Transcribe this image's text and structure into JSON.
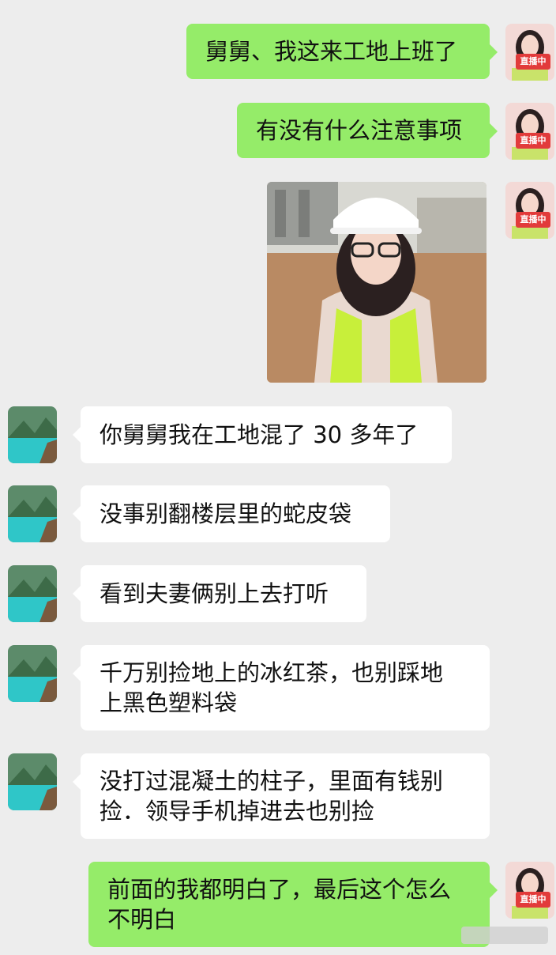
{
  "badge_label": "直播中",
  "messages": [
    {
      "side": "right",
      "lines": [
        "舅舅、我这来工地上班了"
      ]
    },
    {
      "side": "right",
      "lines": [
        "有没有什么注意事项"
      ]
    },
    {
      "side": "right",
      "type": "image",
      "description_icon": "construction-selfie-photo"
    },
    {
      "side": "left",
      "lines": [
        "你舅舅我在工地混了 30 多年了"
      ]
    },
    {
      "side": "left",
      "lines": [
        "没事别翻楼层里的蛇皮袋"
      ]
    },
    {
      "side": "left",
      "lines": [
        "看到夫妻俩别上去打听"
      ]
    },
    {
      "side": "left",
      "lines": [
        "千万别捡地上的冰红茶，也别踩地",
        "上黑色塑料袋"
      ]
    },
    {
      "side": "left",
      "lines": [
        "没打过混凝土的柱子，里面有钱别",
        "捡．领导手机掉进去也别捡"
      ]
    },
    {
      "side": "right",
      "lines": [
        "前面的我都明白了，最后这个怎么",
        "不明白"
      ]
    }
  ],
  "colors": {
    "background": "#ededed",
    "sent_bubble": "#95ec69",
    "received_bubble": "#ffffff",
    "live_badge": "#e23b3b"
  }
}
